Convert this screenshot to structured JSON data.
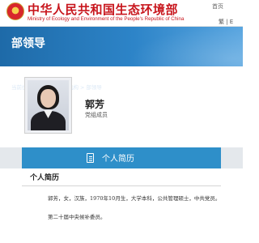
{
  "header": {
    "site_title": "中华人民共和国生态环境部",
    "site_subtitle": "Ministry of Ecology and Environment of the People's Republic of China",
    "home_link": "首页",
    "lang_links": "繁 | E"
  },
  "banner": {
    "title": "部领导",
    "breadcrumb_prefix": "当前位置：",
    "breadcrumb": [
      "首页",
      ">",
      "组织机构",
      ">",
      "部领导"
    ]
  },
  "profile": {
    "name": "郭芳",
    "role": "党组成员"
  },
  "tab": {
    "icon": "document-icon",
    "label": "个人简历"
  },
  "section": {
    "title": "个人简历",
    "lines": [
      "郭芳，女，汉族，1970年10月生，大学本科，公共管理硕士，中共党员。",
      "第二十届中央候补委员。"
    ]
  },
  "colors": {
    "brand_red": "#c8161d",
    "banner_blue": "#1e6aa8",
    "tab_blue": "#2e8fc9"
  }
}
